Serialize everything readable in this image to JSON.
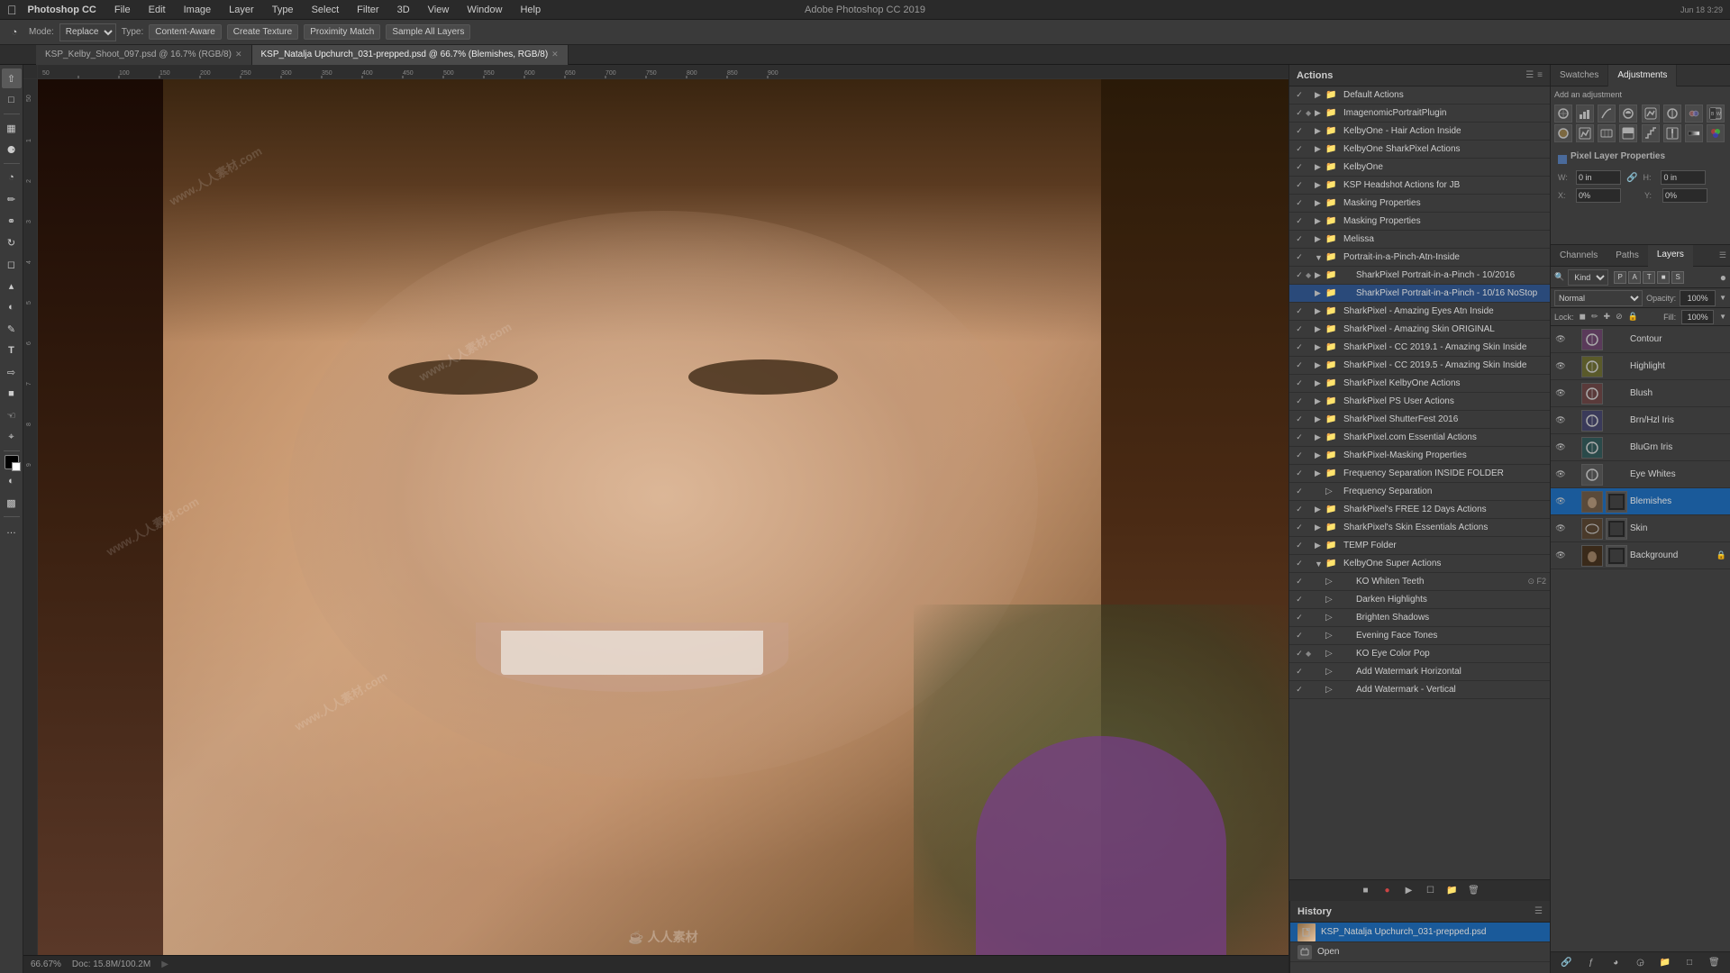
{
  "app": {
    "name": "Photoshop CC",
    "window_title": "Adobe Photoshop CC 2019",
    "os": "macOS",
    "time": "Jun 18  3:29"
  },
  "menubar": {
    "items": [
      "Photoshop CC",
      "File",
      "Edit",
      "Image",
      "Layer",
      "Type",
      "Select",
      "Filter",
      "3D",
      "View",
      "Window",
      "Help"
    ]
  },
  "toolbar": {
    "mode_label": "Mode:",
    "mode_value": "Replace",
    "type_label": "Type:",
    "type_value": "Content-Aware",
    "create_texture": "Create Texture",
    "proximity_match": "Proximity Match",
    "sample_all_layers": "Sample All Layers"
  },
  "tabs": [
    {
      "name": "tab-1",
      "label": "KSP_Kelby_Shoot_097.psd @ 16.7% (RGB/8)",
      "active": false
    },
    {
      "name": "tab-2",
      "label": "KSP_Natalja Upchurch_031-prepped.psd @ 66.7% (Blemishes, RGB/8)",
      "active": true
    }
  ],
  "status_bar": {
    "zoom": "66.67%",
    "doc_size": "Doc: 15.8M/100.2M",
    "extra": ""
  },
  "actions_panel": {
    "title": "Actions",
    "items": [
      {
        "id": 1,
        "checked": true,
        "hasMenu": false,
        "expanded": false,
        "indent": 0,
        "icon": "folder",
        "name": "Default Actions",
        "highlighted": false
      },
      {
        "id": 2,
        "checked": true,
        "hasMenu": true,
        "expanded": false,
        "indent": 0,
        "icon": "folder",
        "name": "ImagenomicPortraitPlugin",
        "highlighted": false,
        "red": true
      },
      {
        "id": 3,
        "checked": true,
        "hasMenu": false,
        "expanded": false,
        "indent": 0,
        "icon": "folder",
        "name": "KelbyOne - Hair Action Inside",
        "highlighted": false
      },
      {
        "id": 4,
        "checked": true,
        "hasMenu": false,
        "expanded": false,
        "indent": 0,
        "icon": "folder",
        "name": "KelbyOne SharkPixel Actions",
        "highlighted": false
      },
      {
        "id": 5,
        "checked": true,
        "hasMenu": false,
        "expanded": false,
        "indent": 0,
        "icon": "folder",
        "name": "KelbyOne",
        "highlighted": false
      },
      {
        "id": 6,
        "checked": true,
        "hasMenu": false,
        "expanded": false,
        "indent": 0,
        "icon": "folder",
        "name": "KSP Headshot Actions for JB",
        "highlighted": false
      },
      {
        "id": 7,
        "checked": true,
        "hasMenu": false,
        "expanded": false,
        "indent": 0,
        "icon": "folder",
        "name": "Masking Properties",
        "highlighted": false
      },
      {
        "id": 8,
        "checked": true,
        "hasMenu": false,
        "expanded": false,
        "indent": 0,
        "icon": "folder",
        "name": "Masking Properties",
        "highlighted": false
      },
      {
        "id": 9,
        "checked": true,
        "hasMenu": false,
        "expanded": false,
        "indent": 0,
        "icon": "folder",
        "name": "Melissa",
        "highlighted": false
      },
      {
        "id": 10,
        "checked": true,
        "hasMenu": false,
        "expanded": true,
        "indent": 0,
        "icon": "folder",
        "name": "Portrait-in-a-Pinch-Atn-Inside",
        "highlighted": false
      },
      {
        "id": 11,
        "checked": true,
        "hasMenu": true,
        "expanded": false,
        "indent": 1,
        "icon": "folder",
        "name": "SharkPixel Portrait-in-a-Pinch - 10/2016",
        "highlighted": false
      },
      {
        "id": 12,
        "checked": false,
        "hasMenu": false,
        "expanded": false,
        "indent": 1,
        "icon": "folder",
        "name": "SharkPixel Portrait-in-a-Pinch - 10/16 NoStop",
        "highlighted": true
      },
      {
        "id": 13,
        "checked": true,
        "hasMenu": false,
        "expanded": false,
        "indent": 0,
        "icon": "folder",
        "name": "SharkPixel - Amazing Eyes Atn Inside",
        "highlighted": false
      },
      {
        "id": 14,
        "checked": true,
        "hasMenu": false,
        "expanded": false,
        "indent": 0,
        "icon": "folder",
        "name": "SharkPixel - Amazing Skin ORIGINAL",
        "highlighted": false
      },
      {
        "id": 15,
        "checked": true,
        "hasMenu": false,
        "expanded": false,
        "indent": 0,
        "icon": "folder",
        "name": "SharkPixel - CC 2019.1 - Amazing Skin Inside",
        "highlighted": false
      },
      {
        "id": 16,
        "checked": true,
        "hasMenu": false,
        "expanded": false,
        "indent": 0,
        "icon": "folder",
        "name": "SharkPixel - CC 2019.5 - Amazing Skin Inside",
        "highlighted": false
      },
      {
        "id": 17,
        "checked": true,
        "hasMenu": false,
        "expanded": false,
        "indent": 0,
        "icon": "folder",
        "name": "SharkPixel KelbyOne Actions",
        "highlighted": false
      },
      {
        "id": 18,
        "checked": true,
        "hasMenu": false,
        "expanded": false,
        "indent": 0,
        "icon": "folder",
        "name": "SharkPixel PS User Actions",
        "highlighted": false
      },
      {
        "id": 19,
        "checked": true,
        "hasMenu": false,
        "expanded": false,
        "indent": 0,
        "icon": "folder",
        "name": "SharkPixel ShutterFest 2016",
        "highlighted": false
      },
      {
        "id": 20,
        "checked": true,
        "hasMenu": false,
        "expanded": false,
        "indent": 0,
        "icon": "folder",
        "name": "SharkPixel.com Essential Actions",
        "highlighted": false
      },
      {
        "id": 21,
        "checked": true,
        "hasMenu": false,
        "expanded": false,
        "indent": 0,
        "icon": "folder",
        "name": "SharkPixel-Masking Properties",
        "highlighted": false
      },
      {
        "id": 22,
        "checked": true,
        "hasMenu": false,
        "expanded": false,
        "indent": 0,
        "icon": "folder",
        "name": "Frequency Separation INSIDE FOLDER",
        "highlighted": false
      },
      {
        "id": 23,
        "checked": true,
        "hasMenu": false,
        "expanded": false,
        "indent": 0,
        "icon": "action",
        "name": "Frequency Separation",
        "highlighted": false
      },
      {
        "id": 24,
        "checked": true,
        "hasMenu": false,
        "expanded": false,
        "indent": 0,
        "icon": "folder",
        "name": "SharkPixel's FREE 12 Days Actions",
        "highlighted": false
      },
      {
        "id": 25,
        "checked": true,
        "hasMenu": false,
        "expanded": false,
        "indent": 0,
        "icon": "folder",
        "name": "SharkPixel's Skin Essentials Actions",
        "highlighted": false
      },
      {
        "id": 26,
        "checked": true,
        "hasMenu": false,
        "expanded": false,
        "indent": 0,
        "icon": "folder",
        "name": "TEMP Folder",
        "highlighted": false
      },
      {
        "id": 27,
        "checked": true,
        "hasMenu": false,
        "expanded": true,
        "indent": 0,
        "icon": "folder",
        "name": "KelbyOne Super Actions",
        "highlighted": false
      },
      {
        "id": 28,
        "checked": true,
        "hasMenu": false,
        "expanded": false,
        "indent": 1,
        "icon": "action",
        "name": "KO Whiten Teeth",
        "shortcut": "F2",
        "highlighted": false
      },
      {
        "id": 29,
        "checked": true,
        "hasMenu": false,
        "expanded": false,
        "indent": 1,
        "icon": "action",
        "name": "Darken Highlights",
        "highlighted": false
      },
      {
        "id": 30,
        "checked": true,
        "hasMenu": false,
        "expanded": false,
        "indent": 1,
        "icon": "action",
        "name": "Brighten Shadows",
        "highlighted": false
      },
      {
        "id": 31,
        "checked": true,
        "hasMenu": false,
        "expanded": false,
        "indent": 1,
        "icon": "action",
        "name": "Evening Face Tones",
        "highlighted": false
      },
      {
        "id": 32,
        "checked": true,
        "hasMenu": true,
        "expanded": false,
        "indent": 1,
        "icon": "action",
        "name": "KO Eye Color Pop",
        "highlighted": false
      },
      {
        "id": 33,
        "checked": true,
        "hasMenu": false,
        "expanded": false,
        "indent": 1,
        "icon": "action",
        "name": "Add Watermark Horizontal",
        "highlighted": false
      },
      {
        "id": 34,
        "checked": true,
        "hasMenu": false,
        "expanded": false,
        "indent": 1,
        "icon": "action",
        "name": "Add Watermark - Vertical",
        "highlighted": false
      }
    ]
  },
  "swatches_adjustments": {
    "tabs": [
      "Swatches",
      "Adjustments"
    ],
    "active_tab": "Adjustments",
    "adjustment_icons": [
      "B/W",
      "▲",
      "●",
      "◐",
      "≋",
      "≡",
      "⬛",
      "C",
      "S",
      "V",
      "L",
      "◑",
      "≈",
      "▓",
      "PS",
      "⊕"
    ],
    "properties": {
      "title": "Pixel Layer Properties",
      "w_label": "W:",
      "w_value": "0 in",
      "h_label": "H:",
      "h_value": "0 in",
      "x_label": "X:",
      "x_value": "0%",
      "y_label": "Y:",
      "y_value": "0%"
    }
  },
  "layers": {
    "tabs": [
      "Channels",
      "Paths",
      "Layers"
    ],
    "active_tab": "Layers",
    "search_placeholder": "Kind",
    "blend_mode": "Normal",
    "opacity": "100%",
    "fill": "100%",
    "lock_icons": [
      "🔒",
      "✛",
      "⊘",
      "⊛"
    ],
    "items": [
      {
        "id": 1,
        "visible": true,
        "name": "Contour",
        "type": "adjustment",
        "linked": false,
        "locked": false,
        "selected": false
      },
      {
        "id": 2,
        "visible": true,
        "name": "Highlight",
        "type": "adjustment",
        "linked": false,
        "locked": false,
        "selected": false
      },
      {
        "id": 3,
        "visible": true,
        "name": "Blush",
        "type": "adjustment",
        "linked": false,
        "locked": false,
        "selected": false
      },
      {
        "id": 4,
        "visible": true,
        "name": "Brn/Hzl Iris",
        "type": "adjustment",
        "linked": false,
        "locked": false,
        "selected": false
      },
      {
        "id": 5,
        "visible": true,
        "name": "BluGrn Iris",
        "type": "adjustment",
        "linked": false,
        "locked": false,
        "selected": false
      },
      {
        "id": 6,
        "visible": true,
        "name": "Eye Whites",
        "type": "adjustment",
        "linked": false,
        "locked": false,
        "selected": false
      },
      {
        "id": 7,
        "visible": true,
        "name": "Blemishes",
        "type": "pixel",
        "linked": false,
        "locked": false,
        "selected": true
      },
      {
        "id": 8,
        "visible": true,
        "name": "Skin",
        "type": "smart",
        "linked": false,
        "locked": false,
        "selected": false
      },
      {
        "id": 9,
        "visible": true,
        "name": "Background",
        "type": "pixel",
        "linked": false,
        "locked": true,
        "selected": false
      }
    ]
  },
  "history": {
    "title": "History",
    "items": [
      {
        "id": 1,
        "icon": "document",
        "name": "KSP_Natalja Upchurch_031-prepped.psd"
      },
      {
        "id": 2,
        "icon": "open",
        "name": "Open"
      }
    ]
  },
  "ruler_marks": [
    "50",
    "100",
    "150",
    "200",
    "250",
    "300",
    "350",
    "400",
    "450",
    "500",
    "550",
    "600",
    "650",
    "700",
    "750",
    "800",
    "850",
    "900"
  ]
}
